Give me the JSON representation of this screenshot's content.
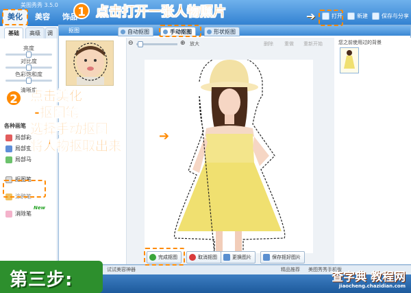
{
  "app": {
    "title": "美图秀秀 3.5.0",
    "main_tabs": [
      "美化",
      "美容",
      "饰品"
    ],
    "toolbar": {
      "open": "打开",
      "new": "新建",
      "save": "保存与分享"
    }
  },
  "left_panel": {
    "subtabs": [
      "基础",
      "高级",
      "调色"
    ],
    "sliders": [
      {
        "label": "亮度",
        "value": 0.5
      },
      {
        "label": "对比度",
        "value": 0.5
      },
      {
        "label": "色彩饱和度",
        "value": 0.5
      },
      {
        "label": "清晰度",
        "value": 0.5
      }
    ],
    "section_title": "各种画笔",
    "tools": [
      "局部彩",
      "局部变",
      "局部马",
      "抠图笔",
      "涂鸦笔",
      "消除笔"
    ],
    "new_badge": "New"
  },
  "dialog": {
    "title": "抠图",
    "tabs": [
      "自动抠图",
      "手动抠图",
      "形状抠图"
    ],
    "zoom_label": "放大",
    "tool_buttons": [
      "删除",
      "重做",
      "重新开始"
    ],
    "right_title": "您之前使用过的背景",
    "buttons": [
      "完成抠图",
      "取消抠图",
      "更换图片",
      "保存抠好图片"
    ]
  },
  "statusbar": {
    "left_text": "试试美容神器",
    "right_text": "精品推荐",
    "app_label": "美图秀秀手机版"
  },
  "annotations": {
    "step1_num": "1",
    "step1_text": "点击打开一张人物照片",
    "step2_num": "2",
    "step2_lines": [
      "点击美化",
      "-抠图笔",
      "选择手动抠图",
      "将人物抠取出来"
    ],
    "step3": "第三步:"
  },
  "watermark": {
    "main": "查字典 教程网",
    "url": "jiaocheng.chazidian.com"
  },
  "colors": {
    "accent": "#ff8a00",
    "step_bg": "#2d8f2d",
    "app_blue": "#2f7fd0"
  }
}
